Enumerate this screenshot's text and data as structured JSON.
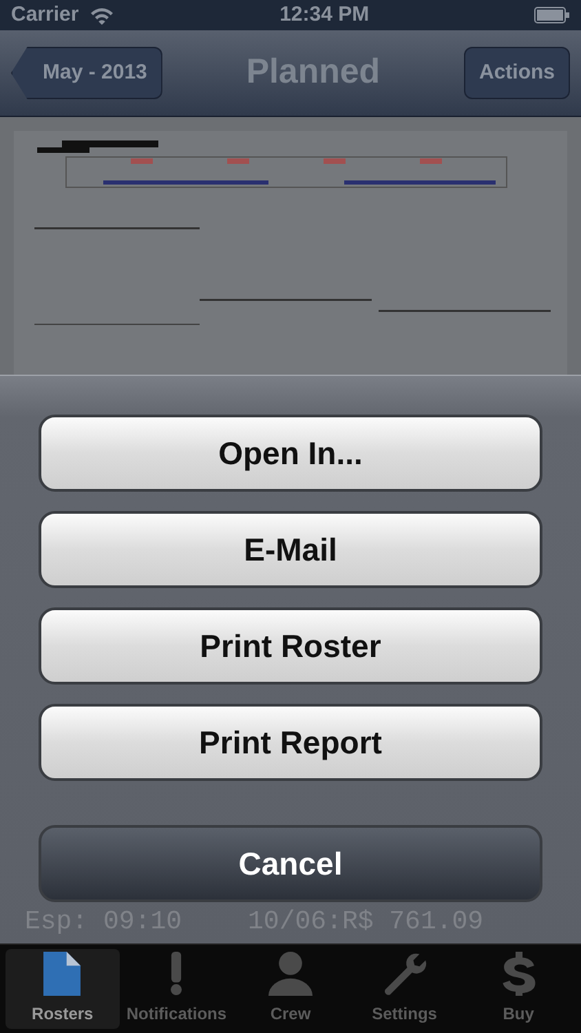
{
  "status_bar": {
    "carrier": "Carrier",
    "time": "12:34 PM"
  },
  "nav_bar": {
    "back": "May - 2013",
    "title": "Planned",
    "action": "Actions"
  },
  "document": {
    "kind": "picture",
    "lines": [
      "Esp:  09:10",
      "10/06:R$  761.09"
    ]
  },
  "action_sheet": {
    "buttons": [
      {
        "label": "Open In...",
        "kind": "default"
      },
      {
        "label": "E-Mail",
        "kind": "default"
      },
      {
        "label": "Print Roster",
        "kind": "default"
      },
      {
        "label": "Print Report",
        "kind": "default"
      },
      {
        "label": "Cancel",
        "kind": "cancel"
      }
    ]
  },
  "tab_bar": [
    {
      "label": "Rosters",
      "kind": "document",
      "selected": true
    },
    {
      "label": "Notifications",
      "kind": "exclamation",
      "selected": false
    },
    {
      "label": "Crew",
      "kind": "person",
      "selected": false
    },
    {
      "label": "Settings",
      "kind": "wrench",
      "selected": false
    },
    {
      "label": "Buy",
      "kind": "dollar",
      "selected": false
    }
  ]
}
